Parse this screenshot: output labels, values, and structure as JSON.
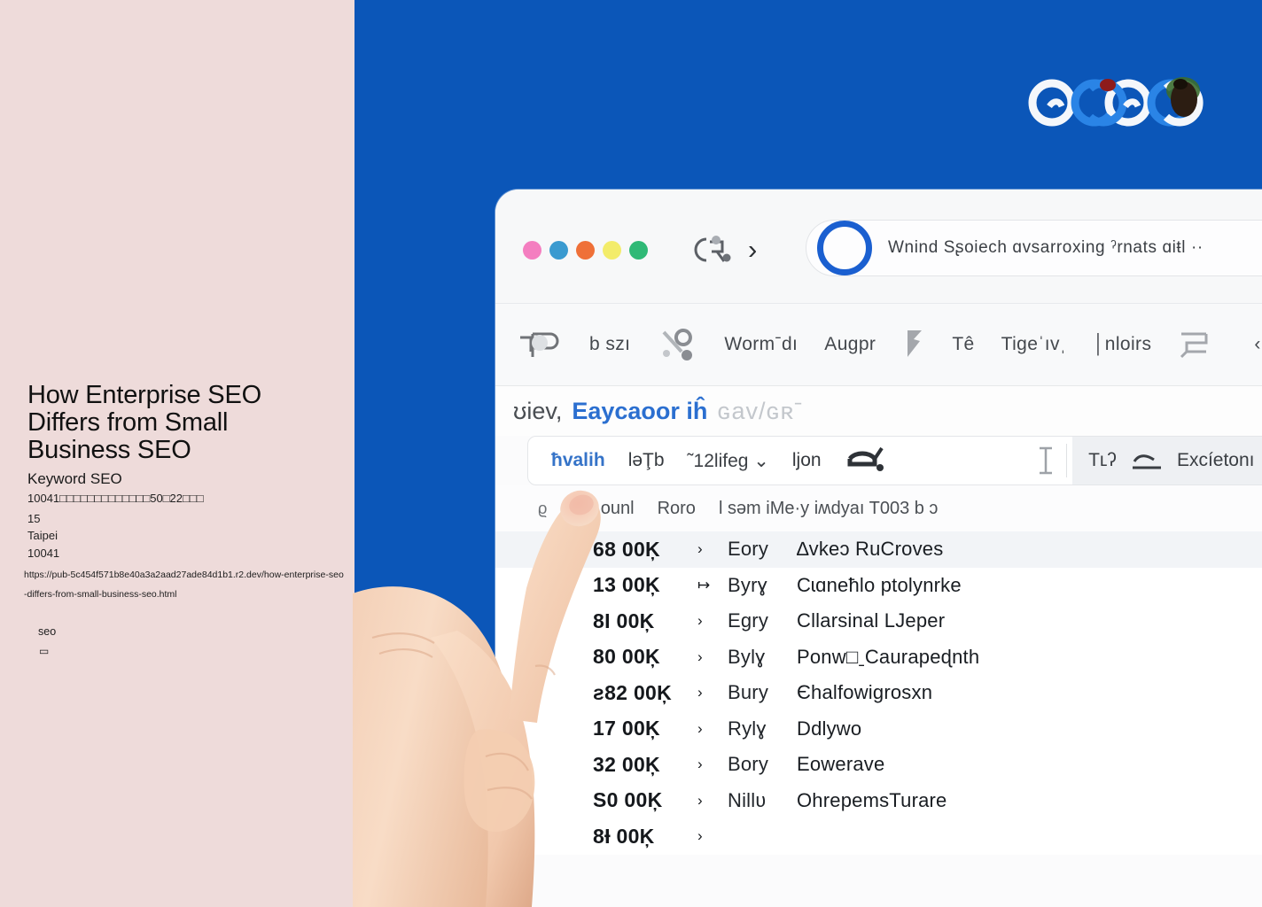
{
  "left_panel": {
    "title": "How Enterprise SEO Differs from Small Business SEO",
    "subtitle": "Keyword SEO",
    "address_line": "10041□□□□□□□□□□□□□50□22□□□",
    "address_number": "15",
    "city": "Taipei",
    "postal_code": "10041",
    "url": "https://pub-5c454f571b8e40a3a2aad27ade84d1b1.r2.dev/how-enterprise-seo-differs-from-small-business-seo.html",
    "tag": "seo",
    "tag_glyph": "▭",
    "bg_color": "#eedbda"
  },
  "background": {
    "blue": "#0b56b8"
  },
  "logo": {
    "name": "garbled-google-logo",
    "ring_white": "#f4f7fb",
    "ring_blue": "#1f7ae0",
    "accent_red": "#8e1b1b",
    "accent_green": "#3b6b2f",
    "accent_dark": "#2c1d12"
  },
  "browser": {
    "traffic_lights": [
      {
        "name": "pink",
        "color": "#f47ec0"
      },
      {
        "name": "blue",
        "color": "#3a9ad0"
      },
      {
        "name": "orange",
        "color": "#ef7038"
      },
      {
        "name": "yellow",
        "color": "#f3ec6a"
      },
      {
        "name": "green",
        "color": "#2fb976"
      }
    ],
    "nav_glyph": "back-arrow-glyph",
    "nav_chevron": "›",
    "omnibox": {
      "ring_color": "#1a5fd0",
      "text": "Wnind Sʂoiech ɑvsarroхing ˀrnats ɑiŧl  ··"
    }
  },
  "toolbar": {
    "items": [
      {
        "type": "icon",
        "name": "pin-shape-icon",
        "label": ""
      },
      {
        "type": "text",
        "name": "toolbar-item-b-szi",
        "label": "b szı"
      },
      {
        "type": "icon",
        "name": "scissors-glyph-icon",
        "label": ""
      },
      {
        "type": "text",
        "name": "toolbar-item-wormdi",
        "label": "Wormˉdı"
      },
      {
        "type": "text",
        "name": "toolbar-item-augpr",
        "label": "Augpr"
      },
      {
        "type": "icon",
        "name": "flag-glyph-icon",
        "label": ""
      },
      {
        "type": "text",
        "name": "toolbar-item-te",
        "label": "Tê"
      },
      {
        "type": "text",
        "name": "toolbar-item-tigeiv",
        "label": "Tigeˈıvˌ"
      },
      {
        "type": "text",
        "name": "toolbar-item-nloirs",
        "label": "│nloirs"
      },
      {
        "type": "icon",
        "name": "tray-glyph-icon",
        "label": ""
      },
      {
        "type": "text",
        "name": "toolbar-item-aural",
        "label": "‹ʜral"
      },
      {
        "type": "icon",
        "name": "rect-glyph-icon",
        "label": ""
      }
    ]
  },
  "page_heading": {
    "pre": "ʊiev,",
    "main": "Eaycaoor iĥ",
    "post": "ɢav/ɢʀˉ"
  },
  "filter_bar": {
    "query": "ħvalih",
    "field": "lǝŢb",
    "dropdown": "˜12lifeg",
    "dropdown_caret": "⌄",
    "lion": "ljon",
    "brush_icon": "brush-glyph-icon",
    "cursor_icon": "text-cursor-icon",
    "right_label_1": "Tʟʔ",
    "right_icon": "underline-glyph-icon",
    "right_label_2": "Excíetonı",
    "right_trailing": "⸌"
  },
  "sub_header": {
    "bullet": "ϱ",
    "col1": "Hly ounƖ",
    "col2": "Roro",
    "col3": "l sǝm iMe·y iʍdyaı T003 b ɔ"
  },
  "data_rows": [
    {
      "metric": "68 00Ķ",
      "arrow": "›",
      "code": "Eory",
      "label": "∆vkeɔ  RuCroves",
      "alt": true
    },
    {
      "metric": "13 00Ķ",
      "arrow": "↦",
      "code": "Byrɣ",
      "label": "Cɩɑneħlo ptolynrke",
      "alt": false
    },
    {
      "metric": "8I 00Ķ",
      "arrow": "›",
      "code": "Egry",
      "label": "Cllarsinal LJeper",
      "alt": false
    },
    {
      "metric": "80 00Ķ",
      "arrow": "›",
      "code": "Bylɣ",
      "label": "Ponw□ˍCaurapeɖnth",
      "alt": false
    },
    {
      "metric": "ƨ82 00Ķ",
      "arrow": "›",
      "code": "Bury",
      "label": "Єhalfowigrosxn",
      "alt": false
    },
    {
      "metric": "17 00Ķ",
      "arrow": "›",
      "code": "Rylɣ",
      "label": "Ddlywo",
      "alt": false
    },
    {
      "metric": "32 00Ķ",
      "arrow": "›",
      "code": "Bory",
      "label": "Eowerave",
      "alt": false
    },
    {
      "metric": "S0 00Ķ",
      "arrow": "›",
      "code": "Nillʋ",
      "label": "OhrepemsTurare",
      "alt": false
    },
    {
      "metric": "8Ɨ 00Ķ",
      "arrow": "›",
      "code": "",
      "label": "",
      "alt": false
    }
  ],
  "hand": {
    "name": "pointing-hand",
    "skin_light": "#f7d8c2",
    "skin_mid": "#eec2a6",
    "skin_shadow": "#dba88a"
  }
}
